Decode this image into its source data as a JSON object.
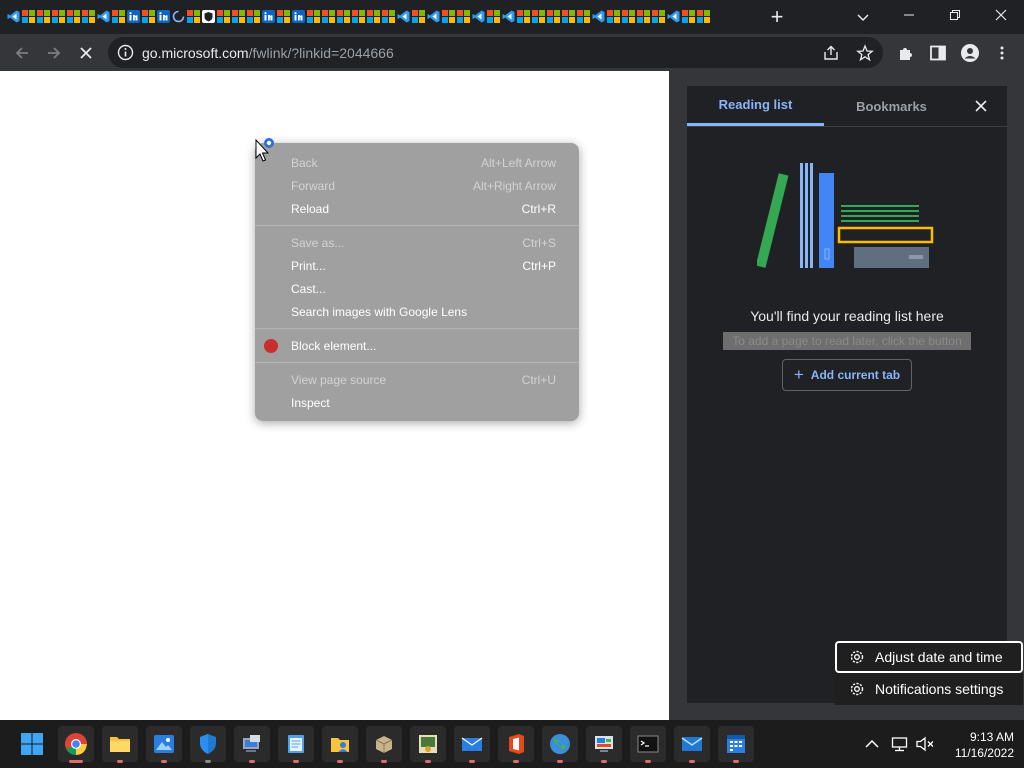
{
  "browser": {
    "tab_icons": [
      "vscode",
      "ms",
      "ms",
      "ms",
      "ms",
      "ms",
      "vscode",
      "ms",
      "linkedin",
      "ms",
      "linkedin",
      "spinner",
      "ms",
      "shield",
      "ms",
      "ms",
      "ms",
      "linkedin",
      "ms",
      "linkedin",
      "ms",
      "ms",
      "ms",
      "ms",
      "ms",
      "ms",
      "vscode",
      "ms",
      "vscode",
      "ms",
      "ms",
      "vscode",
      "ms",
      "vscode",
      "ms",
      "ms",
      "ms",
      "ms",
      "ms",
      "vscode",
      "ms",
      "ms",
      "ms",
      "ms",
      "vscode",
      "ms",
      "ms"
    ],
    "new_tab": "+",
    "address_host": "go.microsoft.com",
    "address_path": "/fwlink/?linkid=2044666"
  },
  "context_menu": {
    "items": [
      {
        "label": "Back",
        "shortcut": "Alt+Left Arrow",
        "enabled": false
      },
      {
        "label": "Forward",
        "shortcut": "Alt+Right Arrow",
        "enabled": false
      },
      {
        "label": "Reload",
        "shortcut": "Ctrl+R",
        "enabled": true
      },
      {
        "label": "Save as...",
        "shortcut": "Ctrl+S",
        "enabled": false
      },
      {
        "label": "Print...",
        "shortcut": "Ctrl+P",
        "enabled": true
      },
      {
        "label": "Cast...",
        "shortcut": "",
        "enabled": true
      },
      {
        "label": "Search images with Google Lens",
        "shortcut": "",
        "enabled": true
      },
      {
        "label": "Block element...",
        "shortcut": "",
        "enabled": true,
        "icon": "ublock-icon"
      },
      {
        "label": "View page source",
        "shortcut": "Ctrl+U",
        "enabled": false
      },
      {
        "label": "Inspect",
        "shortcut": "",
        "enabled": true
      }
    ]
  },
  "side_panel": {
    "tabs": [
      "Reading list",
      "Bookmarks"
    ],
    "active_tab": "Reading list",
    "empty_title": "You'll find your reading list here",
    "empty_subtitle": "To add a page to read later, click the button",
    "add_button": "Add current tab"
  },
  "tray_menu": {
    "items": [
      "Adjust date and time",
      "Notifications settings"
    ]
  },
  "taskbar": {
    "apps": [
      "start",
      "chrome",
      "file-explorer",
      "photos",
      "windows-security",
      "remote-desktop",
      "notepad",
      "user-folder",
      "package",
      "certificate",
      "mail-envelope",
      "office",
      "earth",
      "control-panel",
      "terminal",
      "mail",
      "calendar"
    ],
    "time": "9:13 AM",
    "date": "11/16/2022"
  },
  "colors": {
    "accent_blue": "#8ab4f8",
    "menu_bg": "#a0a0a0",
    "panel_bg": "#202124",
    "toolbar_bg": "#35363a"
  }
}
